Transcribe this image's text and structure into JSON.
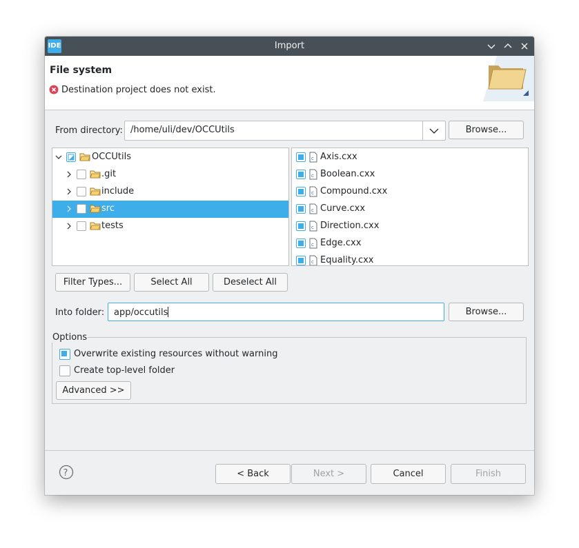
{
  "window": {
    "app_icon_text": "IDE",
    "title": "Import"
  },
  "header": {
    "title": "File system",
    "message": "Destination project does not exist."
  },
  "source": {
    "label": "From directory:",
    "value": "/home/uli/dev/OCCUtils",
    "browse_label": "Browse..."
  },
  "tree": {
    "items": [
      {
        "label": "OCCUtils",
        "expanded": true,
        "check": "partial"
      },
      {
        "label": ".git",
        "expanded": false,
        "check": "off"
      },
      {
        "label": "include",
        "expanded": false,
        "check": "off"
      },
      {
        "label": "src",
        "expanded": false,
        "check": "off",
        "selected": true
      },
      {
        "label": "tests",
        "expanded": false,
        "check": "off"
      }
    ]
  },
  "files": {
    "items": [
      {
        "label": "Axis.cxx",
        "checked": true
      },
      {
        "label": "Boolean.cxx",
        "checked": true
      },
      {
        "label": "Compound.cxx",
        "checked": true
      },
      {
        "label": "Curve.cxx",
        "checked": true
      },
      {
        "label": "Direction.cxx",
        "checked": true
      },
      {
        "label": "Edge.cxx",
        "checked": true
      },
      {
        "label": "Equality.cxx",
        "checked": true
      }
    ]
  },
  "selection_buttons": {
    "filter_types": "Filter Types...",
    "select_all": "Select All",
    "deselect_all": "Deselect All"
  },
  "destination": {
    "label": "Into folder:",
    "value": "app/occutils",
    "browse_label": "Browse..."
  },
  "options": {
    "title": "Options",
    "overwrite_label": "Overwrite existing resources without warning",
    "overwrite_checked": true,
    "toplevel_label": "Create top-level folder",
    "toplevel_checked": false,
    "advanced_label": "Advanced >>"
  },
  "footer": {
    "back_label": "< Back",
    "next_label": "Next >",
    "cancel_label": "Cancel",
    "finish_label": "Finish"
  },
  "colors": {
    "accent": "#3daee9",
    "titlebar": "#475057",
    "window_bg": "#eff0f1",
    "error": "#da4453"
  }
}
